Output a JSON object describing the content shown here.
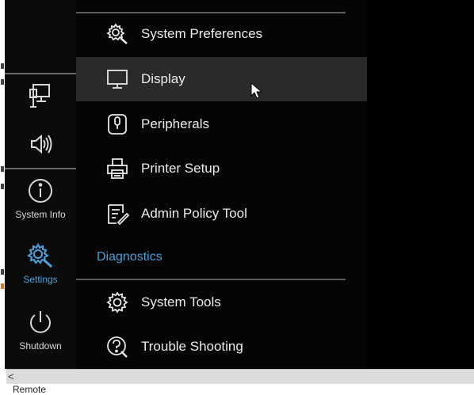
{
  "sidebar": {
    "items": [
      {
        "label": "",
        "icon": "network-monitor-icon"
      },
      {
        "label": "",
        "icon": "speaker-icon"
      },
      {
        "label": "System Info",
        "icon": "info-icon"
      },
      {
        "label": "Settings",
        "icon": "settings-icon",
        "active": true
      },
      {
        "label": "Shutdown",
        "icon": "power-icon"
      }
    ]
  },
  "menu": {
    "items": [
      {
        "label": "System Preferences",
        "icon": "system-preferences-icon"
      },
      {
        "label": "Display",
        "icon": "monitor-icon",
        "hovered": true
      },
      {
        "label": "Peripherals",
        "icon": "mouse-icon"
      },
      {
        "label": "Printer Setup",
        "icon": "printer-icon"
      },
      {
        "label": "Admin Policy Tool",
        "icon": "admin-policy-icon"
      }
    ],
    "section_label": "Diagnostics",
    "diagnostics_items": [
      {
        "label": "System Tools",
        "icon": "gear-icon"
      },
      {
        "label": "Trouble Shooting",
        "icon": "troubleshooting-icon"
      }
    ]
  },
  "scrollbar": {
    "left_arrow": "<"
  },
  "status": {
    "text": "Remote"
  },
  "colors": {
    "accent": "#4aa3df",
    "background": "#050505",
    "hover": "#2a2a2a"
  }
}
